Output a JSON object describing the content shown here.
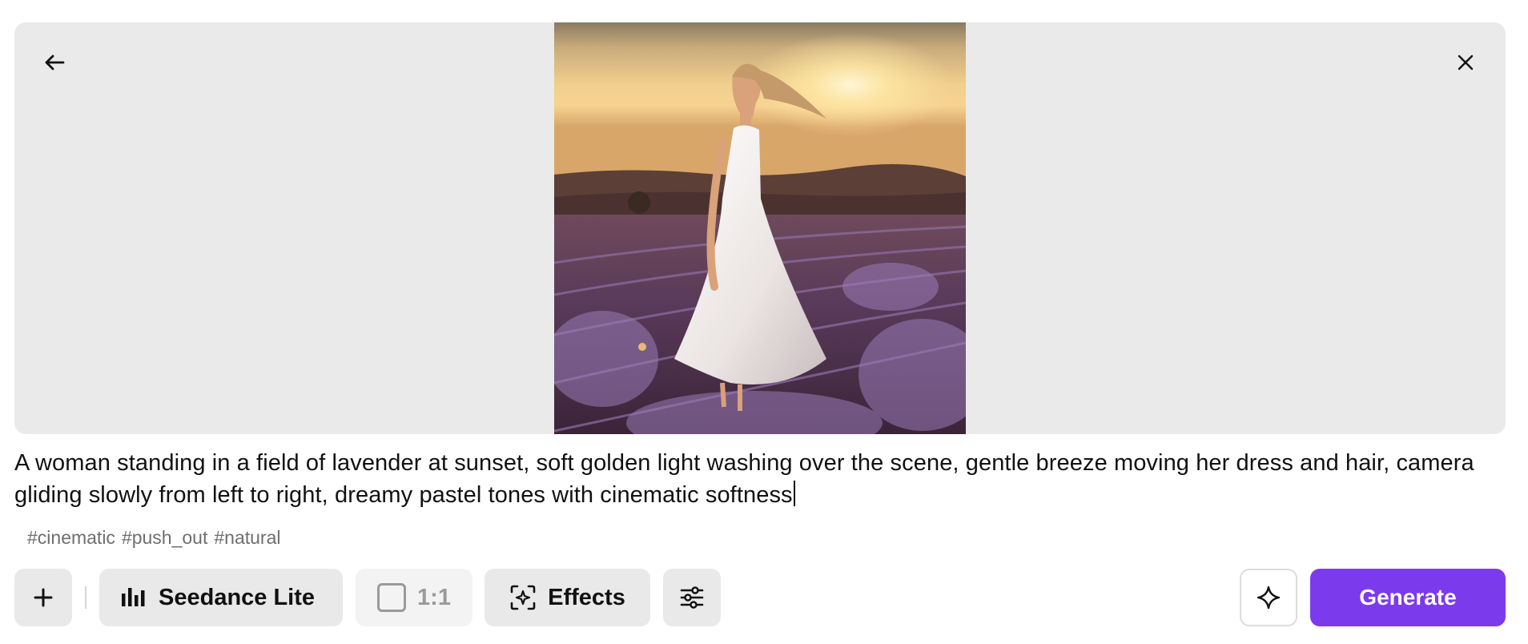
{
  "preview": {
    "image_alt": "Woman in white dress standing in lavender field at sunset"
  },
  "prompt": {
    "text": "A woman standing in a field of lavender at sunset, soft golden light washing over the scene, gentle breeze moving her dress and hair, camera gliding slowly from left to right, dreamy pastel tones with cinematic softness"
  },
  "tags": [
    "#cinematic",
    "#push_out",
    "#natural"
  ],
  "toolbar": {
    "model_label": "Seedance Lite",
    "ratio_label": "1:1",
    "effects_label": "Effects",
    "generate_label": "Generate"
  },
  "colors": {
    "accent": "#7c3aed",
    "button_bg": "#e9e9e9",
    "preview_bg": "#eaeaea"
  },
  "icons": [
    "back-arrow-icon",
    "close-icon",
    "plus-icon",
    "model-bars-icon",
    "square-ratio-icon",
    "effects-icon",
    "sliders-icon",
    "sparkle-icon"
  ]
}
